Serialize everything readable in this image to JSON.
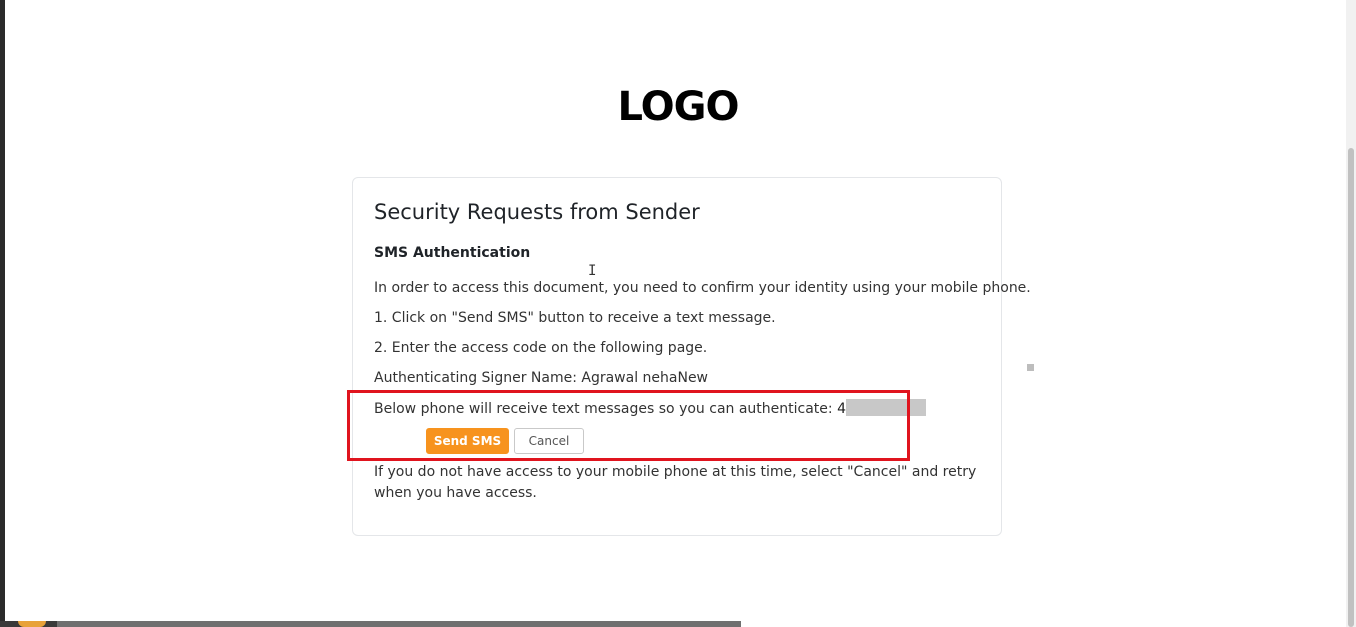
{
  "logo": {
    "text": "LOGO"
  },
  "card": {
    "title": "Security Requests from Sender",
    "subheading": "SMS Authentication",
    "intro": "In order to access this document, you need to confirm your identity using your mobile phone.",
    "step1": "1. Click on \"Send SMS\" button to receive a text message.",
    "step2": "2. Enter the access code on the following page.",
    "signer": "Authenticating Signer Name: Agrawal nehaNew",
    "phone_text": "Below phone will receive text messages so you can authenticate: ",
    "phone_visible_prefix": "4",
    "send_button": "Send SMS",
    "cancel_button": "Cancel",
    "footer": "If you do not have access to your mobile phone at this time, select \"Cancel\" and retry when you have access."
  },
  "colors": {
    "accent": "#f7931e",
    "highlight": "#e0141e"
  },
  "icons": {
    "cursor": "text-cursor-icon"
  }
}
